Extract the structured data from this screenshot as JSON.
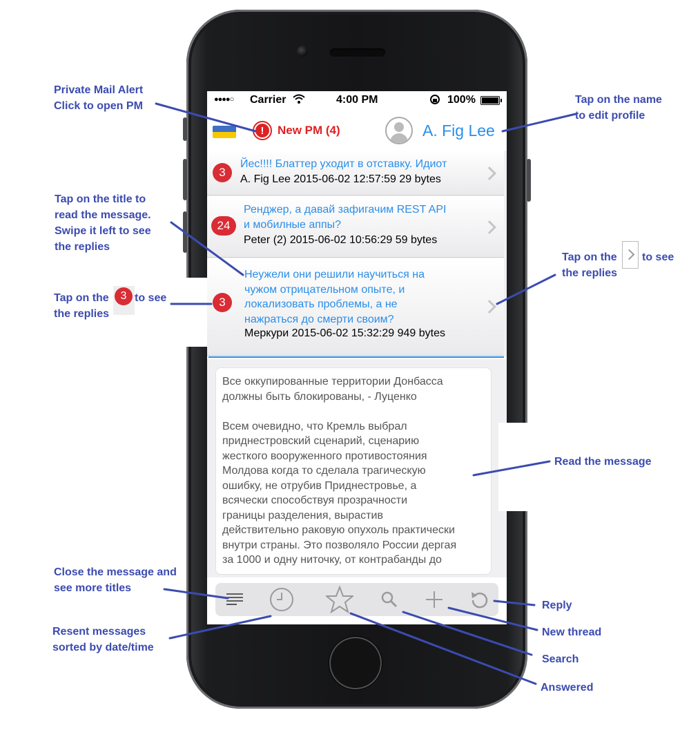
{
  "status_bar": {
    "signal": "●●●●○",
    "carrier": "Carrier",
    "time": "4:00 PM",
    "battery": "100%",
    "wifi_icon": "wifi-icon"
  },
  "header": {
    "pm_icon": "!",
    "pm_label": "New PM (4)",
    "profile_name": "A. Fig Lee"
  },
  "threads": [
    {
      "badge": "3",
      "title": "Йес!!!! Блаттер уходит в отставку. Идиот",
      "meta": "A. Fig Lee 2015-06-02 12:57:59 29 bytes"
    },
    {
      "badge": "24",
      "title": "Ренджер, а давай зафигачим REST API\nи мобилные аппы?",
      "meta": "Peter (2) 2015-06-02 10:56:29 59 bytes"
    },
    {
      "badge": "3",
      "title": "Неужели они решили научиться на\nчужом отрицательном опыте, и\nлокализовать проблемы, а не\nнажраться до смерти своим?",
      "meta": "Меркури 2015-06-02 15:32:29 949 bytes"
    }
  ],
  "message": {
    "text": "Все оккупированные территории Донбасса\nдолжны быть блокированы, - Луценко\n\nВсем очевидно, что Кремль выбрал\nприднестровский сценарий, сценарию\nжесткого вооруженного противостояния\nМолдова когда то сделала трагическую\nошибку, не отрубив Приднестровье, а\nвсячески способствуя прозрачности\nграницы разделения, вырастив\nдействительно раковую опухоль практически\nвнутри страны. Это позволяло России дергая\nза 1000 и одну ниточку, от контрабанды до"
  },
  "toolbar": [
    "list-icon",
    "clock-icon",
    "star-icon",
    "search-icon",
    "plus-icon",
    "reply-icon"
  ],
  "annotations": {
    "pm": "Private Mail Alert\nClick to open PM",
    "profile": "Tap on the name\nto edit profile",
    "title": "Tap on the title to\nread the message.\nSwipe it left to see\nthe replies",
    "chevron_pre": "Tap on the",
    "chevron_post": "to see",
    "chevron_line2": "the replies",
    "badge_pre": "Tap on the",
    "badge_post": "to see",
    "badge_line2": "the replies",
    "badge_sample": "3",
    "read": "Read the message",
    "close": "Close the message and\nsee more titles",
    "recent": "Resent messages\nsorted by date/time",
    "reply": "Reply",
    "new_thread": "New thread",
    "search": "Search",
    "answered": "Answered"
  },
  "colors": {
    "accent": "#2a8ee8",
    "badge": "#d92c34",
    "alert": "#dd2222",
    "annotation": "#3b4bb0"
  }
}
